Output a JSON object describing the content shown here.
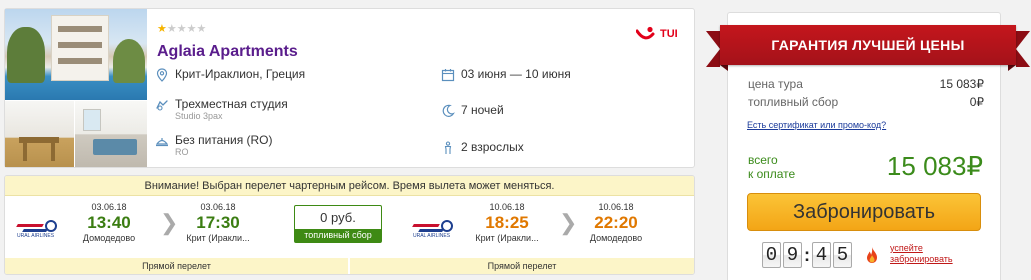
{
  "hotel": {
    "stars_filled": 1,
    "stars_total": 5,
    "name": "Aglaia Apartments",
    "operator_logo": "TUI",
    "location": "Крит-Ираклион, Греция",
    "room": "Трехместная студия",
    "room_sub": "Studio 3pax",
    "meal": "Без питания (RO)",
    "meal_sub": "RO",
    "dates": "03 июня — 10 июня",
    "nights": "7 ночей",
    "pax": "2 взрослых",
    "icons": {
      "location": "map-pin-icon",
      "room": "room-icon",
      "meal": "meal-icon",
      "dates": "calendar-icon",
      "nights": "moon-icon",
      "pax": "person-icon"
    }
  },
  "flights": {
    "notice": "Внимание! Выбран перелет чартерным рейсом. Время вылета может меняться.",
    "outbound": {
      "airline_logo": "URAL AIRLINES",
      "depart_date": "03.06.18",
      "depart_time": "13:40",
      "depart_city": "Домодедово",
      "arrive_date": "03.06.18",
      "arrive_time": "17:30",
      "arrive_city": "Крит (Иракли...",
      "direct": "Прямой перелет"
    },
    "fuel_amount": "0 руб.",
    "fuel_label": "топливный сбор",
    "inbound": {
      "airline_logo": "URAL AIRLINES",
      "depart_date": "10.06.18",
      "depart_time": "18:25",
      "depart_city": "Крит (Иракли...",
      "arrive_date": "10.06.18",
      "arrive_time": "22:20",
      "arrive_city": "Домодедово",
      "direct": "Прямой перелет"
    },
    "arrow": "❯"
  },
  "price": {
    "ribbon": "ГАРАНТИЯ ЛУЧШЕЙ ЦЕНЫ",
    "tour_label": "цена тура",
    "tour_value": "15 083₽",
    "fuel_label": "топливный сбор",
    "fuel_value": "0₽",
    "promo_link": "Есть сертификат или промо-код?",
    "total_label_1": "всего",
    "total_label_2": "к оплате",
    "total_value": "15 083₽",
    "book_button": "Забронировать",
    "timer": [
      "0",
      "9",
      "4",
      "5"
    ],
    "timer_colon": ":",
    "hurry_1": "успейте",
    "hurry_2": "забронировать"
  },
  "colors": {
    "hotel_name": "#5a1d8c",
    "ribbon": "#c4161c",
    "total": "#3b8b1b",
    "button": "#f3a516",
    "depart_time_outbound": "#3b7d12",
    "times_inbound": "#e07800"
  }
}
